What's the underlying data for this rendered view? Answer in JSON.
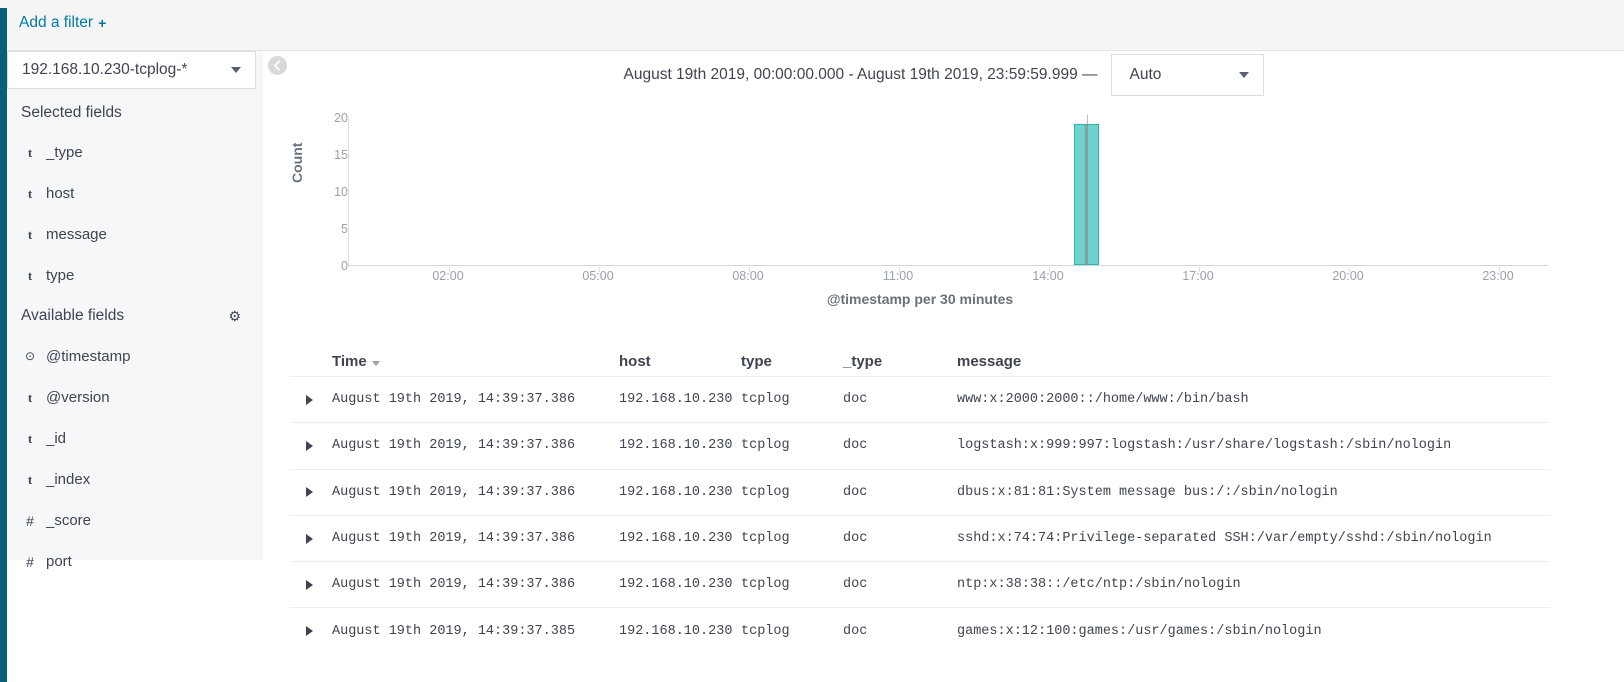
{
  "filter_bar": {
    "add_filter_label": "Add a filter",
    "plus_glyph": "+"
  },
  "sidebar": {
    "index_pattern": "192.168.10.230-tcplog-*",
    "selected_fields_title": "Selected fields",
    "available_fields_title": "Available fields",
    "settings_icon": "gear-icon",
    "selected_fields": [
      {
        "type": "t",
        "name": "_type"
      },
      {
        "type": "t",
        "name": "host"
      },
      {
        "type": "t",
        "name": "message"
      },
      {
        "type": "t",
        "name": "type"
      }
    ],
    "available_fields": [
      {
        "type": "clock",
        "name": "@timestamp"
      },
      {
        "type": "t",
        "name": "@version"
      },
      {
        "type": "t",
        "name": "_id"
      },
      {
        "type": "t",
        "name": "_index"
      },
      {
        "type": "#",
        "name": "_score"
      },
      {
        "type": "#",
        "name": "port"
      }
    ]
  },
  "timerange": {
    "text": "August 19th 2019, 00:00:00.000 - August 19th 2019, 23:59:59.999 —",
    "interval": "Auto"
  },
  "chart_data": {
    "type": "bar",
    "title": "",
    "xlabel": "@timestamp per 30 minutes",
    "ylabel": "Count",
    "ylim": [
      0,
      20
    ],
    "yticks": [
      0,
      5,
      10,
      15,
      20
    ],
    "xticks": [
      "02:00",
      "05:00",
      "08:00",
      "11:00",
      "14:00",
      "17:00",
      "20:00",
      "23:00"
    ],
    "xlim_hours": [
      0,
      24
    ],
    "grid": false,
    "legend": null,
    "bar_color": "#6fd2ce",
    "bar_border_color": "#28b5b0",
    "categories": [
      "14:30"
    ],
    "values": [
      19
    ],
    "bars": [
      {
        "x_hour": 14.5,
        "value": 19,
        "width_minutes": 30
      }
    ]
  },
  "table": {
    "columns": [
      "Time",
      "host",
      "type",
      "_type",
      "message"
    ],
    "sort_column": "Time",
    "sort_direction": "desc",
    "rows": [
      {
        "time": "August 19th 2019, 14:39:37.386",
        "host": "192.168.10.230",
        "type": "tcplog",
        "_type": "doc",
        "message": "www:x:2000:2000::/home/www:/bin/bash"
      },
      {
        "time": "August 19th 2019, 14:39:37.386",
        "host": "192.168.10.230",
        "type": "tcplog",
        "_type": "doc",
        "message": "logstash:x:999:997:logstash:/usr/share/logstash:/sbin/nologin"
      },
      {
        "time": "August 19th 2019, 14:39:37.386",
        "host": "192.168.10.230",
        "type": "tcplog",
        "_type": "doc",
        "message": "dbus:x:81:81:System message bus:/:/sbin/nologin"
      },
      {
        "time": "August 19th 2019, 14:39:37.386",
        "host": "192.168.10.230",
        "type": "tcplog",
        "_type": "doc",
        "message": "sshd:x:74:74:Privilege-separated SSH:/var/empty/sshd:/sbin/nologin"
      },
      {
        "time": "August 19th 2019, 14:39:37.386",
        "host": "192.168.10.230",
        "type": "tcplog",
        "_type": "doc",
        "message": "ntp:x:38:38::/etc/ntp:/sbin/nologin"
      },
      {
        "time": "August 19th 2019, 14:39:37.385",
        "host": "192.168.10.230",
        "type": "tcplog",
        "_type": "doc",
        "message": "games:x:12:100:games:/usr/games:/sbin/nologin"
      }
    ]
  },
  "colors": {
    "accent": "#0079a5",
    "rail": "#0b5e77",
    "teal": "#6fd2ce"
  }
}
